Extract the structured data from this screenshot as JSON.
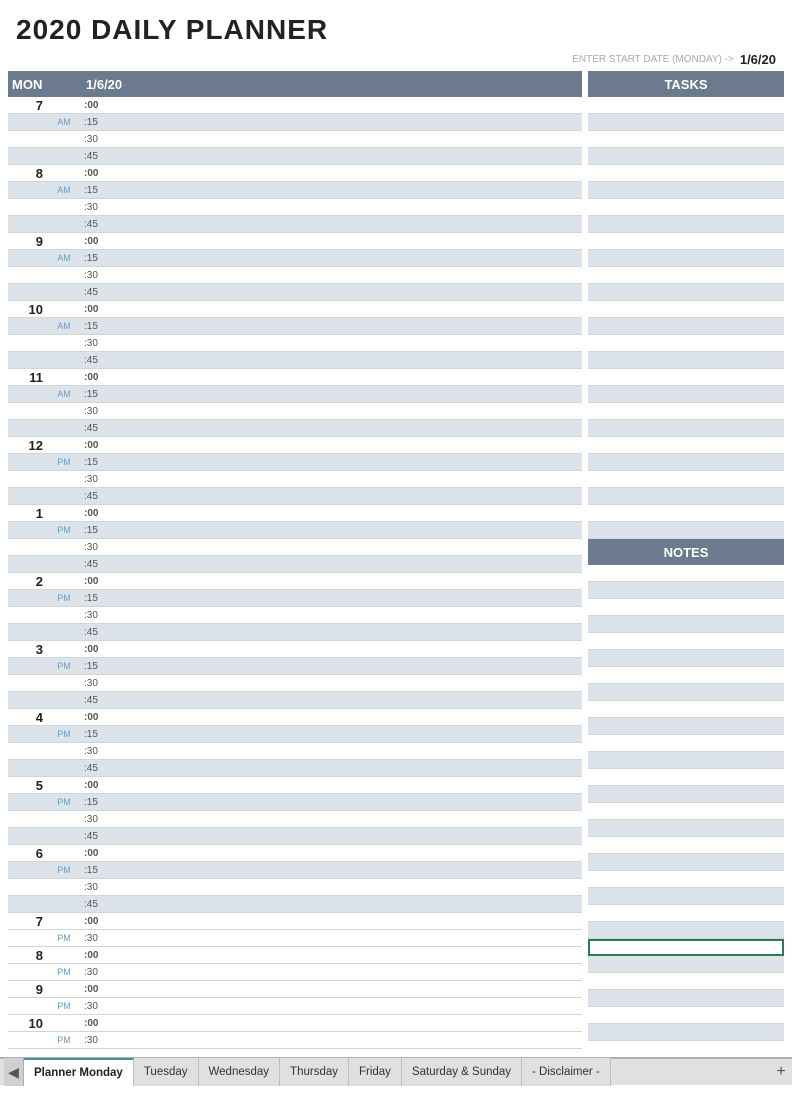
{
  "title": "2020 DAILY PLANNER",
  "start_date_label": "ENTER START DATE (MONDAY) ->",
  "start_date_value": "1/6/20",
  "schedule": {
    "header": {
      "day": "MON",
      "date": "1/6/20"
    },
    "hours": [
      {
        "hour": "7",
        "ampm": "AM",
        "slots": [
          ":00",
          ":15",
          ":30",
          ":45"
        ]
      },
      {
        "hour": "8",
        "ampm": "AM",
        "slots": [
          ":00",
          ":15",
          ":30",
          ":45"
        ]
      },
      {
        "hour": "9",
        "ampm": "AM",
        "slots": [
          ":00",
          ":15",
          ":30",
          ":45"
        ]
      },
      {
        "hour": "10",
        "ampm": "AM",
        "slots": [
          ":00",
          ":15",
          ":30",
          ":45"
        ]
      },
      {
        "hour": "11",
        "ampm": "AM",
        "slots": [
          ":00",
          ":15",
          ":30",
          ":45"
        ]
      },
      {
        "hour": "12",
        "ampm": "PM",
        "slots": [
          ":00",
          ":15",
          ":30",
          ":45"
        ]
      },
      {
        "hour": "1",
        "ampm": "PM",
        "slots": [
          ":00",
          ":15",
          ":30",
          ":45"
        ]
      },
      {
        "hour": "2",
        "ampm": "PM",
        "slots": [
          ":00",
          ":15",
          ":30",
          ":45"
        ]
      },
      {
        "hour": "3",
        "ampm": "PM",
        "slots": [
          ":00",
          ":15",
          ":30",
          ":45"
        ]
      },
      {
        "hour": "4",
        "ampm": "PM",
        "slots": [
          ":00",
          ":15",
          ":30",
          ":45"
        ]
      },
      {
        "hour": "5",
        "ampm": "PM",
        "slots": [
          ":00",
          ":15",
          ":30",
          ":45"
        ]
      },
      {
        "hour": "6",
        "ampm": "PM",
        "slots": [
          ":00",
          ":15",
          ":30",
          ":45"
        ]
      },
      {
        "hour": "7",
        "ampm": "PM",
        "slots": [
          ":00",
          ":30"
        ]
      },
      {
        "hour": "8",
        "ampm": "PM",
        "slots": [
          ":00",
          ":30"
        ]
      },
      {
        "hour": "9",
        "ampm": "PM",
        "slots": [
          ":00",
          ":30"
        ]
      },
      {
        "hour": "10",
        "ampm": "PM",
        "slots": [
          ":00",
          ":30"
        ]
      }
    ]
  },
  "tasks": {
    "header": "TASKS",
    "count": 26
  },
  "notes": {
    "header": "NOTES",
    "count": 28,
    "active_row": 22
  },
  "tabs": [
    {
      "label": "Planner Monday",
      "active": true
    },
    {
      "label": "Tuesday",
      "active": false
    },
    {
      "label": "Wednesday",
      "active": false
    },
    {
      "label": "Thursday",
      "active": false
    },
    {
      "label": "Friday",
      "active": false
    },
    {
      "label": "Saturday & Sunday",
      "active": false
    },
    {
      "label": "- Disclaimer -",
      "active": false
    }
  ],
  "tab_add_label": "+"
}
